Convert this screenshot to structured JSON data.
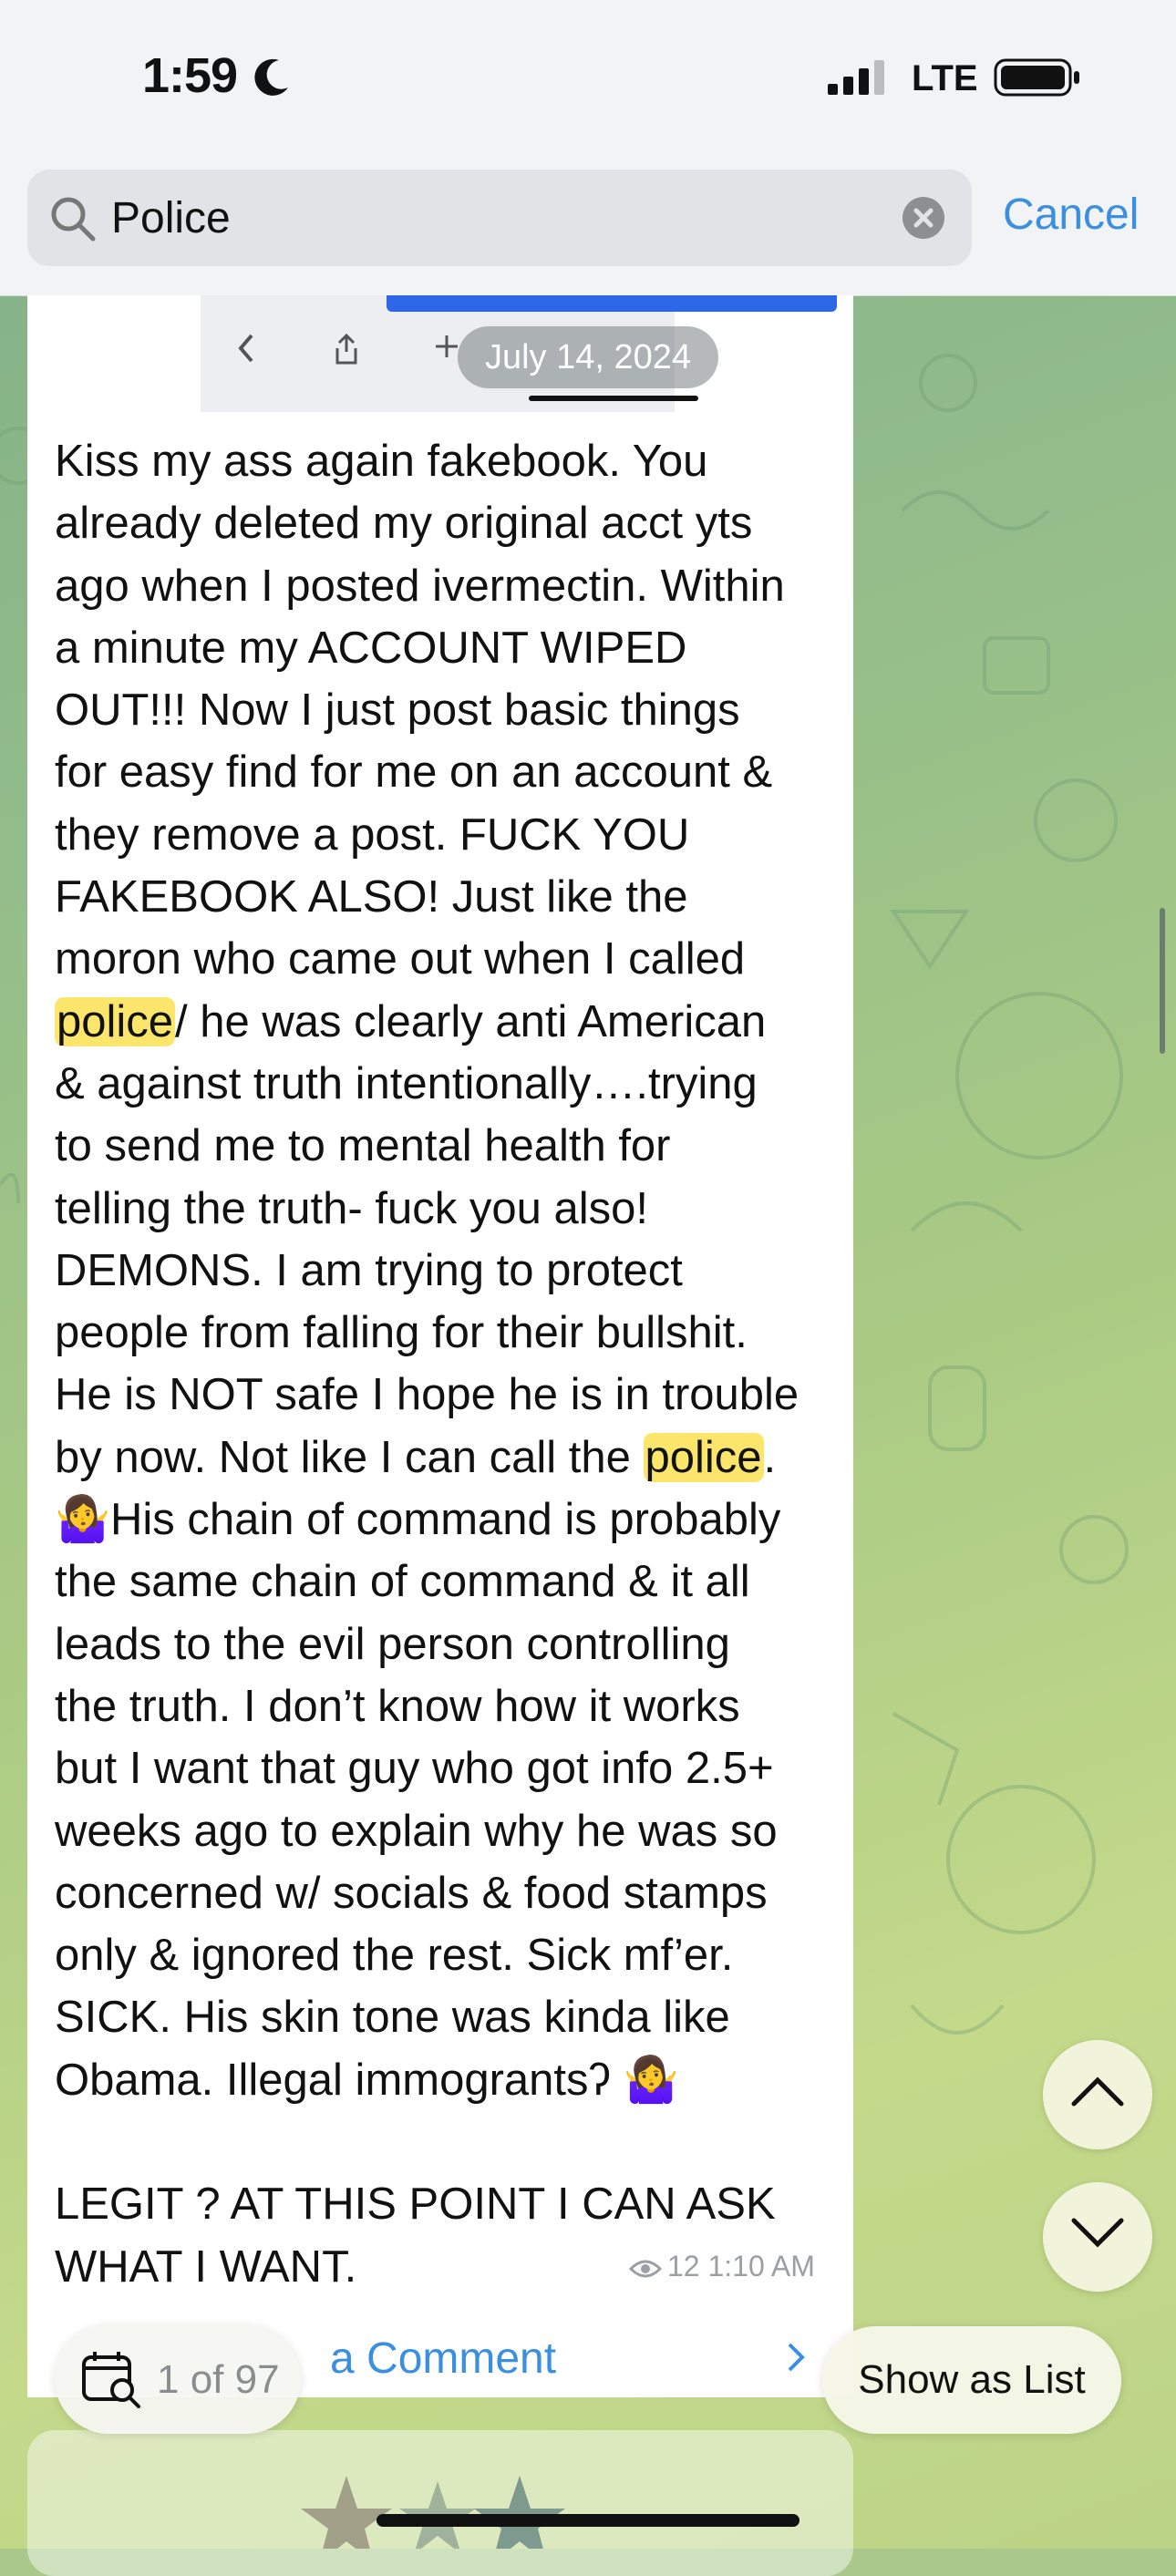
{
  "status_bar": {
    "time": "1:59",
    "network": "LTE"
  },
  "search": {
    "query": "Police",
    "cancel_label": "Cancel"
  },
  "message": {
    "date": "July 14, 2024",
    "segments": [
      "Kiss my ass again fakebook. You\nalready deleted my original acct yts\nago when I posted ivermectin. Within\na minute my ACCOUNT WIPED\nOUT!!! Now I just post basic things\nfor easy find for me on an account &\nthey remove a post. FUCK YOU\nFAKEBOOK ALSO! Just like the\nmoron who came out when I called\n",
      "police",
      "/ he was clearly anti American\n& against truth intentionally….trying\nto send me to mental health for\ntelling the truth- fuck you also!\nDEMONS. I am trying to protect\npeople from falling for their bullshit.\nHe is NOT safe I hope he is in trouble\nby now. Not like I can call the ",
      "police",
      ".\n",
      "🤷‍♀️",
      "His chain of command is probably\nthe same chain of command & it all\nleads to the evil person controlling\nthe truth. I don’t know how it works\nbut I want that guy who got info 2.5+\nweeks ago to explain why he was so\nconcerned w/ socials & food stamps\nonly & ignored the rest. Sick mf’er.\nSICK. His skin tone was kinda like\nObama. Illegal immograntsʔ ",
      "🤷‍♀️",
      "\n\nLEGIT ? AT THIS POINT I CAN ASK\nWHAT I WANT."
    ],
    "views": "12",
    "time": "1:10 AM"
  },
  "comment_label": "a Comment",
  "result_counter": "1 of 97",
  "show_as_list_label": "Show as List",
  "colors": {
    "accent": "#3a8fe0",
    "highlight": "#fbe56a"
  }
}
